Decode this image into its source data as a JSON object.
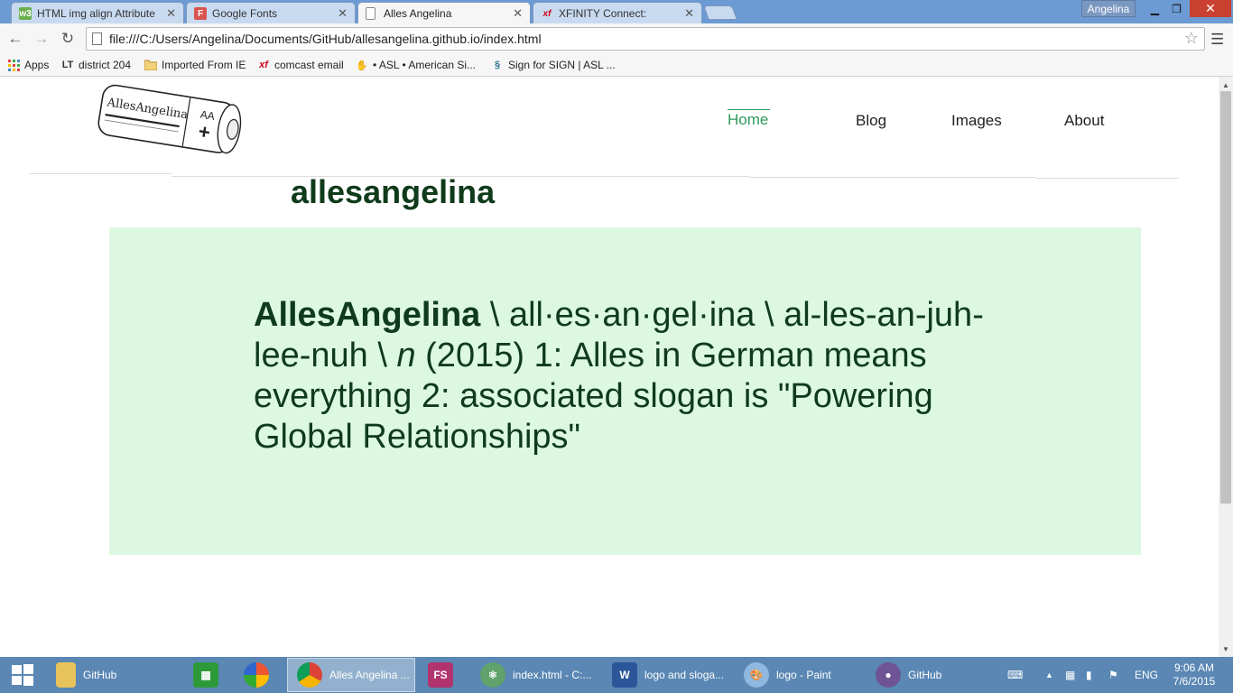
{
  "browser": {
    "tabs": [
      {
        "label": "HTML img align Attribute",
        "icon": "w3-icon",
        "active": false
      },
      {
        "label": "Google Fonts",
        "icon": "google-fonts-icon",
        "active": false
      },
      {
        "label": "Alles Angelina",
        "icon": "page-icon",
        "active": true
      },
      {
        "label": "XFINITY Connect:",
        "icon": "xfinity-icon",
        "active": false
      }
    ],
    "profile_name": "Angelina",
    "url": "file:///C:/Users/Angelina/Documents/GitHub/allesangelina.github.io/index.html",
    "bookmarks": [
      {
        "label": "Apps",
        "icon": "apps-grid-icon"
      },
      {
        "label": "district 204",
        "icon": "lt-icon"
      },
      {
        "label": "Imported From IE",
        "icon": "folder-icon"
      },
      {
        "label": "comcast email",
        "icon": "xfinity-icon"
      },
      {
        "label": "• ASL • American Si...",
        "icon": "asl-hand-icon"
      },
      {
        "label": "Sign for SIGN | ASL ...",
        "icon": "sign-icon"
      }
    ]
  },
  "site": {
    "logo_text": "AllesAngelina",
    "logo_battery_label": "AA",
    "logo_plus": "+",
    "nav": [
      {
        "label": "Home",
        "active": true
      },
      {
        "label": "Blog",
        "active": false
      },
      {
        "label": "Images",
        "active": false
      },
      {
        "label": "About",
        "active": false
      }
    ],
    "title": "allesangelina",
    "definition": {
      "term": "AllesAngelina",
      "pronunciation": " \\ all·es·an·gel·ina \\ al-les-an-juh-lee-nuh \\ ",
      "pos": "n",
      "body": " (2015) 1: Alles in German means everything 2: associated slogan is \"Powering Global Relationships\""
    },
    "colors": {
      "accent": "#2e9a5a",
      "title": "#0f3b1b",
      "box_bg": "#ddf8e1"
    }
  },
  "taskbar": {
    "items": [
      {
        "label": "GitHub",
        "icon": "folder-icon"
      },
      {
        "label": "",
        "icon": "store-icon"
      },
      {
        "label": "",
        "icon": "picasa-icon"
      },
      {
        "label": "Alles Angelina ...",
        "icon": "chrome-icon",
        "active": true
      },
      {
        "label": "FS",
        "icon": "fs-icon"
      },
      {
        "label": "index.html - C:...",
        "icon": "atom-icon"
      },
      {
        "label": "logo and sloga...",
        "icon": "word-icon"
      },
      {
        "label": "logo - Paint",
        "icon": "paint-icon"
      },
      {
        "label": "GitHub",
        "icon": "github-icon"
      }
    ],
    "language": "ENG",
    "time": "9:06 AM",
    "date": "7/6/2015"
  }
}
